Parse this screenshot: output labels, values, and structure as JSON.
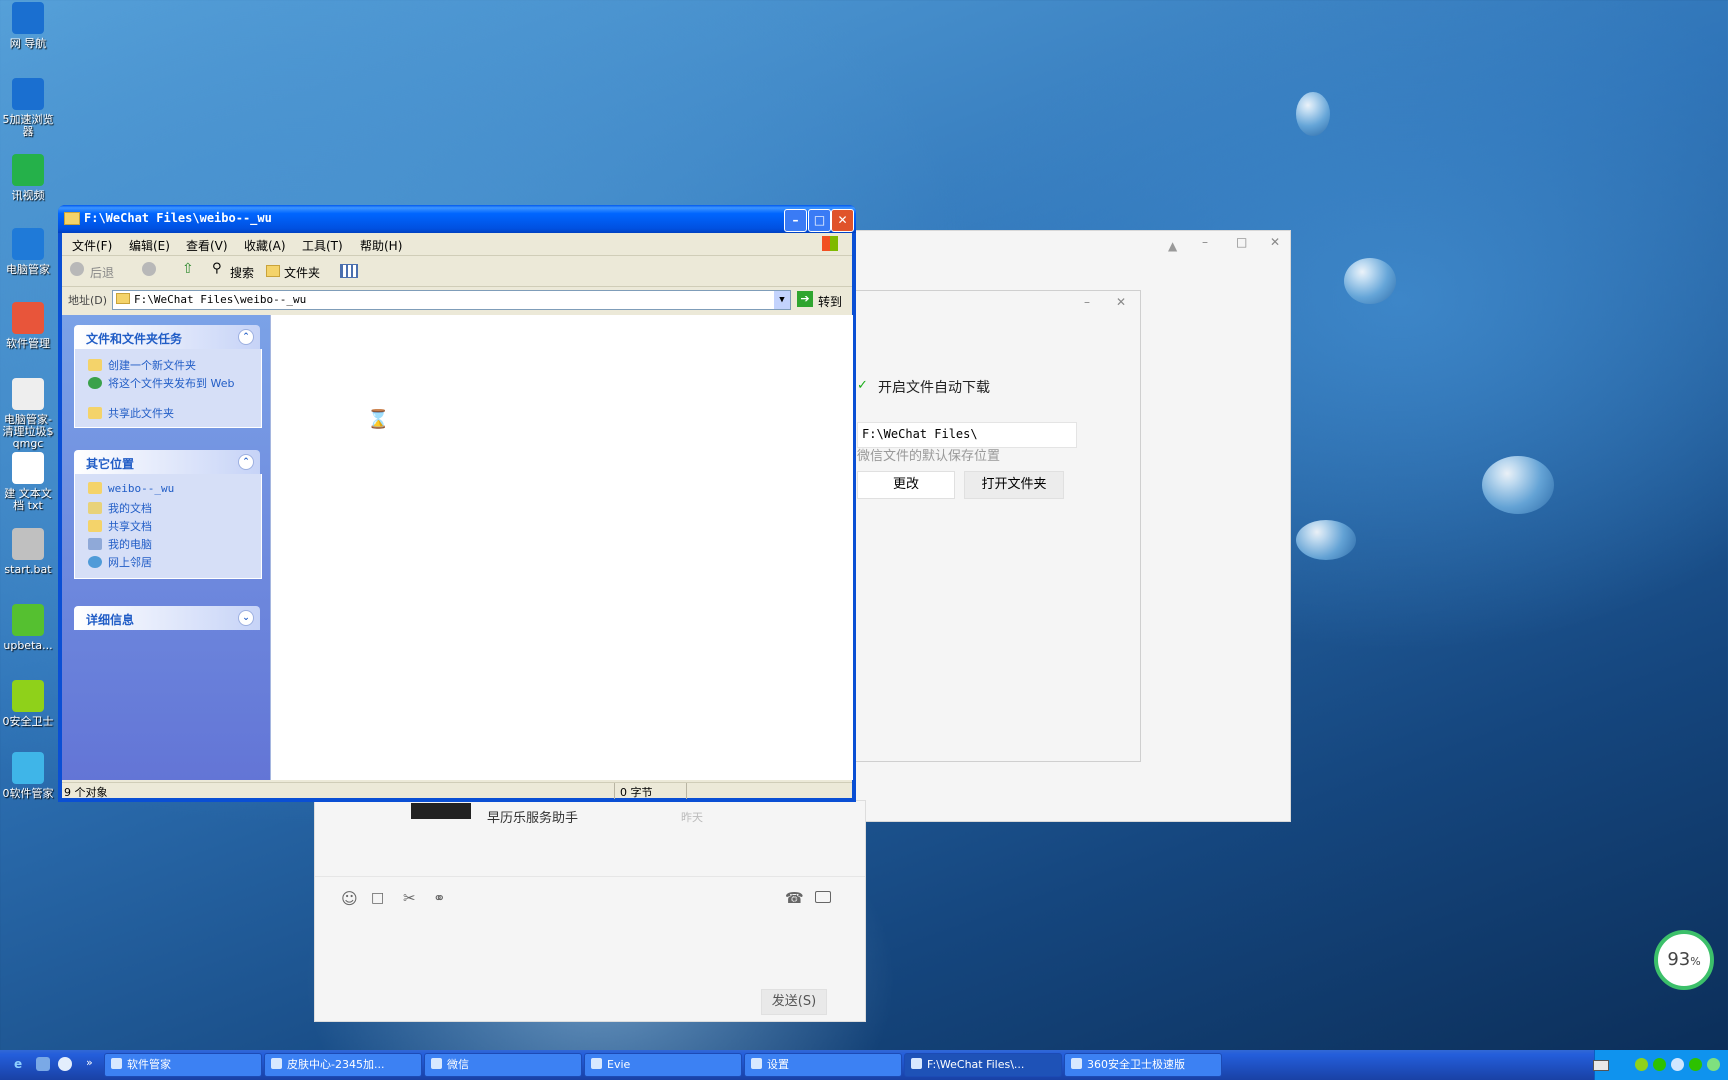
{
  "desktop": {
    "icons": [
      {
        "label": "网 导航",
        "icon": "ie-icon",
        "color": "#1a6fd0"
      },
      {
        "label": "5加速浏览器",
        "icon": "ie-icon",
        "color": "#1a6fd0"
      },
      {
        "label": "讯视频",
        "icon": "video-icon",
        "color": "#25b14a"
      },
      {
        "label": "电脑管家",
        "icon": "shield-icon",
        "color": "#1f7ad8"
      },
      {
        "label": "软件管理",
        "icon": "app-store-icon",
        "color": "#e8553a"
      },
      {
        "label": "电脑管家-清理垃圾$ qmgc",
        "icon": "file-icon",
        "color": "#eeeeee"
      },
      {
        "label": "建 文本文档 txt",
        "icon": "text-file-icon",
        "color": "#ffffff"
      },
      {
        "label": "start.bat",
        "icon": "bat-file-icon",
        "color": "#c0c0c0"
      },
      {
        "label": "upbeta...",
        "icon": "upbeta-icon",
        "color": "#55c030"
      },
      {
        "label": "0安全卫士",
        "icon": "360-icon",
        "color": "#8fd11a"
      },
      {
        "label": "0软件管家",
        "icon": "software-icon",
        "color": "#3fb5e8"
      }
    ]
  },
  "wechat_settings": {
    "auto_download_label": "开启文件自动下载",
    "path_value": "F:\\WeChat Files\\",
    "path_hint": "微信文件的默认保存位置",
    "change_button": "更改",
    "open_folder_button": "打开文件夹"
  },
  "wechat_chat": {
    "partial_item": "早历乐服务助手",
    "partial_time": "昨天",
    "send_button": "发送(S)"
  },
  "explorer": {
    "title": "F:\\WeChat Files\\weibo--_wu",
    "menu": [
      "文件(F)",
      "编辑(E)",
      "查看(V)",
      "收藏(A)",
      "工具(T)",
      "帮助(H)"
    ],
    "toolbar": {
      "back": "后退",
      "search": "搜索",
      "folders": "文件夹"
    },
    "address_label": "地址(D)",
    "address_value": "F:\\WeChat Files\\weibo--_wu",
    "go_button": "转到",
    "tasks_panel": {
      "title": "文件和文件夹任务",
      "items": [
        "创建一个新文件夹",
        "将这个文件夹发布到 Web",
        "共享此文件夹"
      ]
    },
    "other_places_panel": {
      "title": "其它位置",
      "items": [
        "weibo--_wu",
        "我的文档",
        "共享文档",
        "我的电脑",
        "网上邻居"
      ]
    },
    "details_panel": {
      "title": "详细信息"
    },
    "status": {
      "objects": "9 个对象",
      "size": "0 字节"
    }
  },
  "taskbar": {
    "tasks": [
      {
        "label": "软件管家"
      },
      {
        "label": "皮肤中心-2345加..."
      },
      {
        "label": "微信"
      },
      {
        "label": "Evie"
      },
      {
        "label": "设置"
      },
      {
        "label": "F:\\WeChat Files\\..."
      },
      {
        "label": "360安全卫士极速版"
      }
    ]
  },
  "widget": {
    "percent": "93",
    "unit": "%"
  }
}
